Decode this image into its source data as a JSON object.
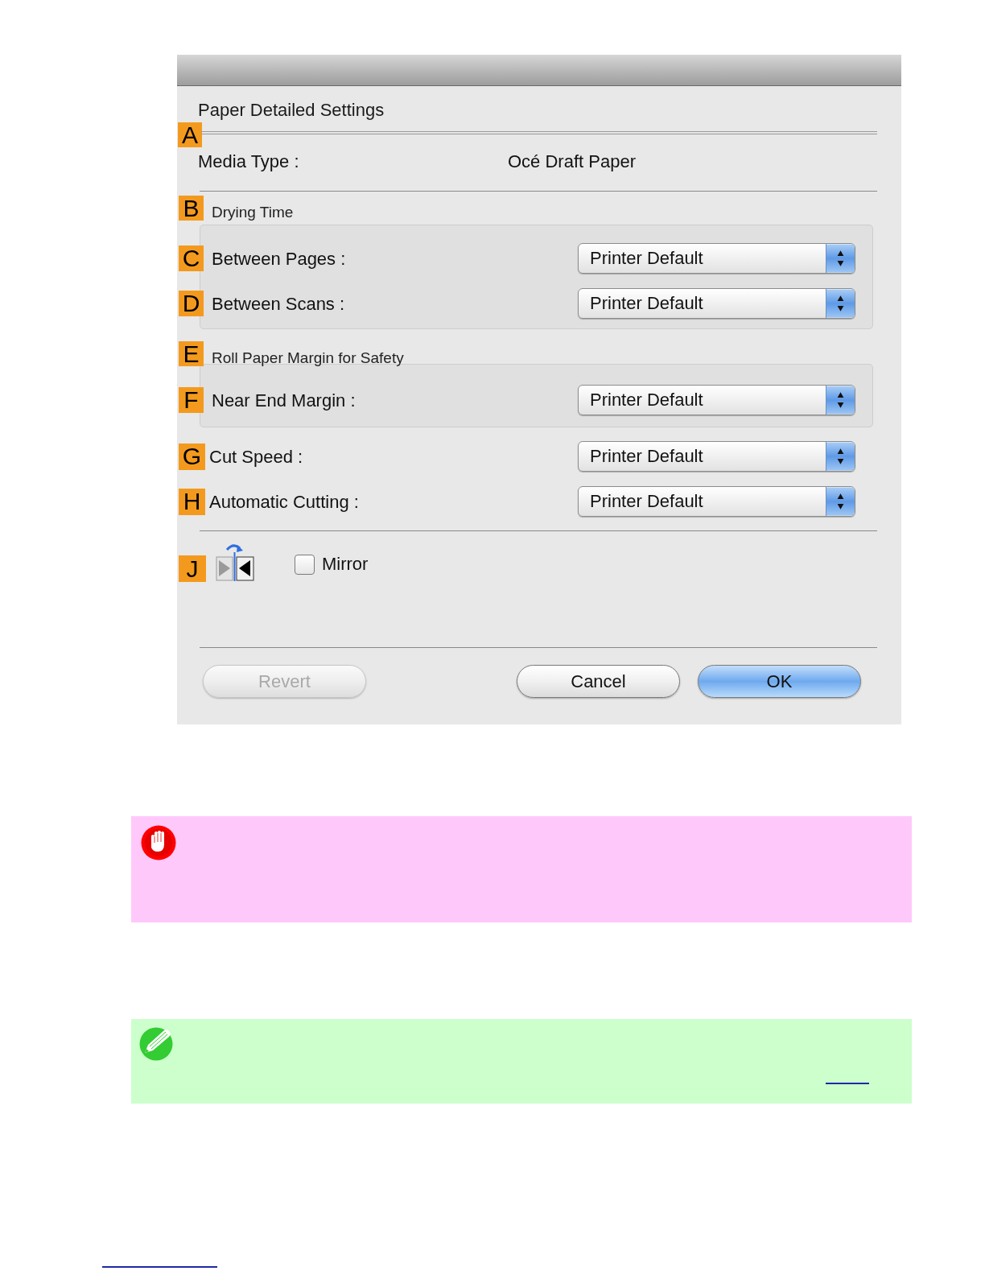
{
  "dialog": {
    "heading": "Paper Detailed Settings",
    "media_type": {
      "marker": "A",
      "label": "Media Type :",
      "value": "Océ Draft Paper"
    },
    "groups": [
      {
        "marker": "B",
        "title": "Drying Time",
        "settings": [
          {
            "marker": "C",
            "label": "Between Pages :",
            "value": "Printer Default"
          },
          {
            "marker": "D",
            "label": "Between Scans :",
            "value": "Printer Default"
          }
        ]
      },
      {
        "marker": "E",
        "title": "Roll Paper Margin for Safety",
        "settings": [
          {
            "marker": "F",
            "label": "Near End Margin :",
            "value": "Printer Default"
          }
        ]
      }
    ],
    "settings": [
      {
        "marker": "G",
        "label": "Cut Speed :",
        "value": "Printer Default"
      },
      {
        "marker": "H",
        "label": "Automatic Cutting :",
        "value": "Printer Default"
      }
    ],
    "mirror": {
      "marker": "J",
      "label": "Mirror",
      "checked": false
    },
    "buttons": [
      {
        "label": "Revert",
        "kind": "plain",
        "disabled": true
      },
      {
        "label": "Cancel",
        "kind": "plain",
        "disabled": false
      },
      {
        "label": "OK",
        "kind": "default",
        "disabled": false
      }
    ]
  },
  "notices": [
    {
      "kind": "important"
    },
    {
      "kind": "note"
    }
  ]
}
